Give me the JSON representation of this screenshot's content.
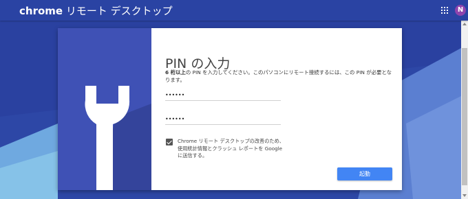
{
  "header": {
    "brand": "chrome",
    "title": "リモート デスクトップ",
    "avatar_initial": "N"
  },
  "dialog": {
    "heading": "PIN の入力",
    "instructions_bold": "6 桁以上",
    "instructions_rest": "の PIN を入力してください。このパソコンにリモート接続するには、この PIN が必要となります。",
    "pin_value": "••••••",
    "pin_confirm_value": "••••••",
    "consent_checked": true,
    "consent_text": "Chrome リモート デスクトップの改善のため、使用統計情報とクラッシュ レポートを Google に送信する。",
    "start_label": "起動"
  },
  "colors": {
    "header": "#2a43a3",
    "background": "#2d47a6",
    "illustration": "#3f51b5",
    "button": "#4285f4",
    "avatar": "#8e44ad"
  },
  "icons": {
    "apps": "apps-grid-icon",
    "illustration": "wrench-icon"
  }
}
